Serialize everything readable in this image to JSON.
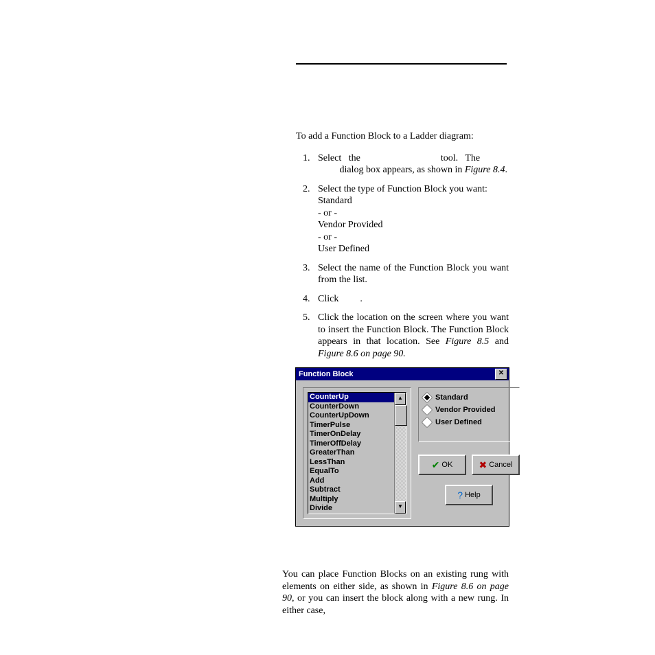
{
  "doc": {
    "intro": "To add a Function Block to a Ladder diagram:",
    "steps": {
      "s1a": "Select",
      "s1b": "the",
      "s1c": "tool.",
      "s1d": "The",
      "s1e": "dialog box appears, as shown in ",
      "s1f": "Figure 8.4",
      "s1g": ".",
      "s2a": "Select the type of Function Block you want:",
      "s2b": "Standard",
      "s2c": "- or -",
      "s2d": "Vendor Provided",
      "s2e": "- or -",
      "s2f": "User Defined",
      "s3": "Select the name of the Function Block you want from the list.",
      "s4a": "Click",
      "s4b": ".",
      "s5a": "Click the location on the screen where you want to insert the Function Block. The Function Block appears in that location. See ",
      "s5b": "Figure 8.5",
      "s5c": " and ",
      "s5d": "Figure 8.6 on page 90."
    },
    "trail_a": "You can place Function Blocks on an existing rung with elements on either side, as shown in ",
    "trail_b": "Figure 8.6 on page 90",
    "trail_c": ", or you can insert the block along with a new rung. In either case,"
  },
  "dialog": {
    "title": "Function Block",
    "close_glyph": "✕",
    "list": {
      "items": [
        "CounterUp",
        "CounterDown",
        "CounterUpDown",
        "TimerPulse",
        "TimerOnDelay",
        "TimerOffDelay",
        "GreaterThan",
        "LessThan",
        "EqualTo",
        "Add",
        "Subtract",
        "Multiply",
        "Divide"
      ],
      "selected_index": 0,
      "up_glyph": "▲",
      "down_glyph": "▼"
    },
    "radios": {
      "r1": "Standard",
      "r2": "Vendor Provided",
      "r3": "User Defined"
    },
    "buttons": {
      "ok_glyph": "✔",
      "ok_label": "OK",
      "cancel_glyph": "✖",
      "cancel_label": "Cancel",
      "help_glyph": "?",
      "help_label": "Help"
    }
  }
}
